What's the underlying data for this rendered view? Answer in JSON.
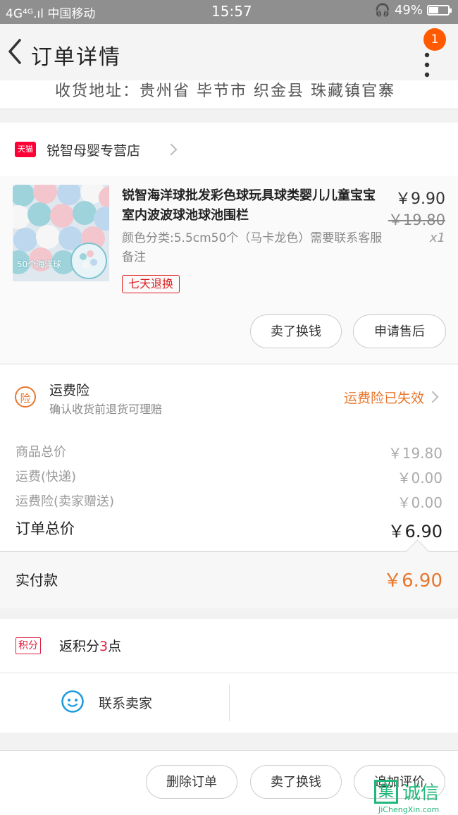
{
  "status_bar": {
    "network": "4G⁴ᴳ.ıl 中国移动",
    "time": "15:57",
    "battery": "49%",
    "battery_level": 0.49
  },
  "nav": {
    "title": "订单详情",
    "badge": "1"
  },
  "address": {
    "text": "收货地址：贵州省 毕节市 织金县 珠藏镇官寨"
  },
  "shop": {
    "badge": "天猫",
    "name": "锐智母婴专营店"
  },
  "product": {
    "title": "锐智海洋球批发彩色球玩具球类婴儿儿童宝宝室内波波球池球池围栏",
    "spec": "颜色分类:5.5cm50个（马卡龙色）需要联系客服备注",
    "price": "￥9.90",
    "original_price": "￥19.80",
    "quantity": "x1",
    "thumb_label": "50个海洋球",
    "return_tag": "七天退换",
    "btn_remind": "卖了换钱",
    "btn_aftersale": "申请售后"
  },
  "insurance": {
    "icon": "险",
    "title": "运费险",
    "subtitle": "确认收货前退货可理赔",
    "status": "运费险已失效"
  },
  "costs": [
    {
      "label": "商品总价",
      "value": "￥19.80"
    },
    {
      "label": "运费(快递)",
      "value": "￥0.00"
    },
    {
      "label": "运费险(卖家赠送)",
      "value": "￥0.00"
    }
  ],
  "total": {
    "label": "订单总价",
    "value": "￥6.90"
  },
  "paid": {
    "label": "实付款",
    "value": "￥6.90"
  },
  "points": {
    "badge": "积分",
    "prefix": "返积分",
    "amount": "3",
    "suffix": "点"
  },
  "contact": {
    "label": "联系卖家"
  },
  "bottom": {
    "delete": "删除订单",
    "sell": "卖了换钱",
    "review": "追加评价"
  },
  "watermark": {
    "char": "集",
    "cn": "诚信",
    "en": "JiChengXin.com"
  },
  "colors": {
    "accent": "#e8772e",
    "tmall": "#ff0036",
    "badge": "#ff5a00",
    "red": "#e02040"
  }
}
